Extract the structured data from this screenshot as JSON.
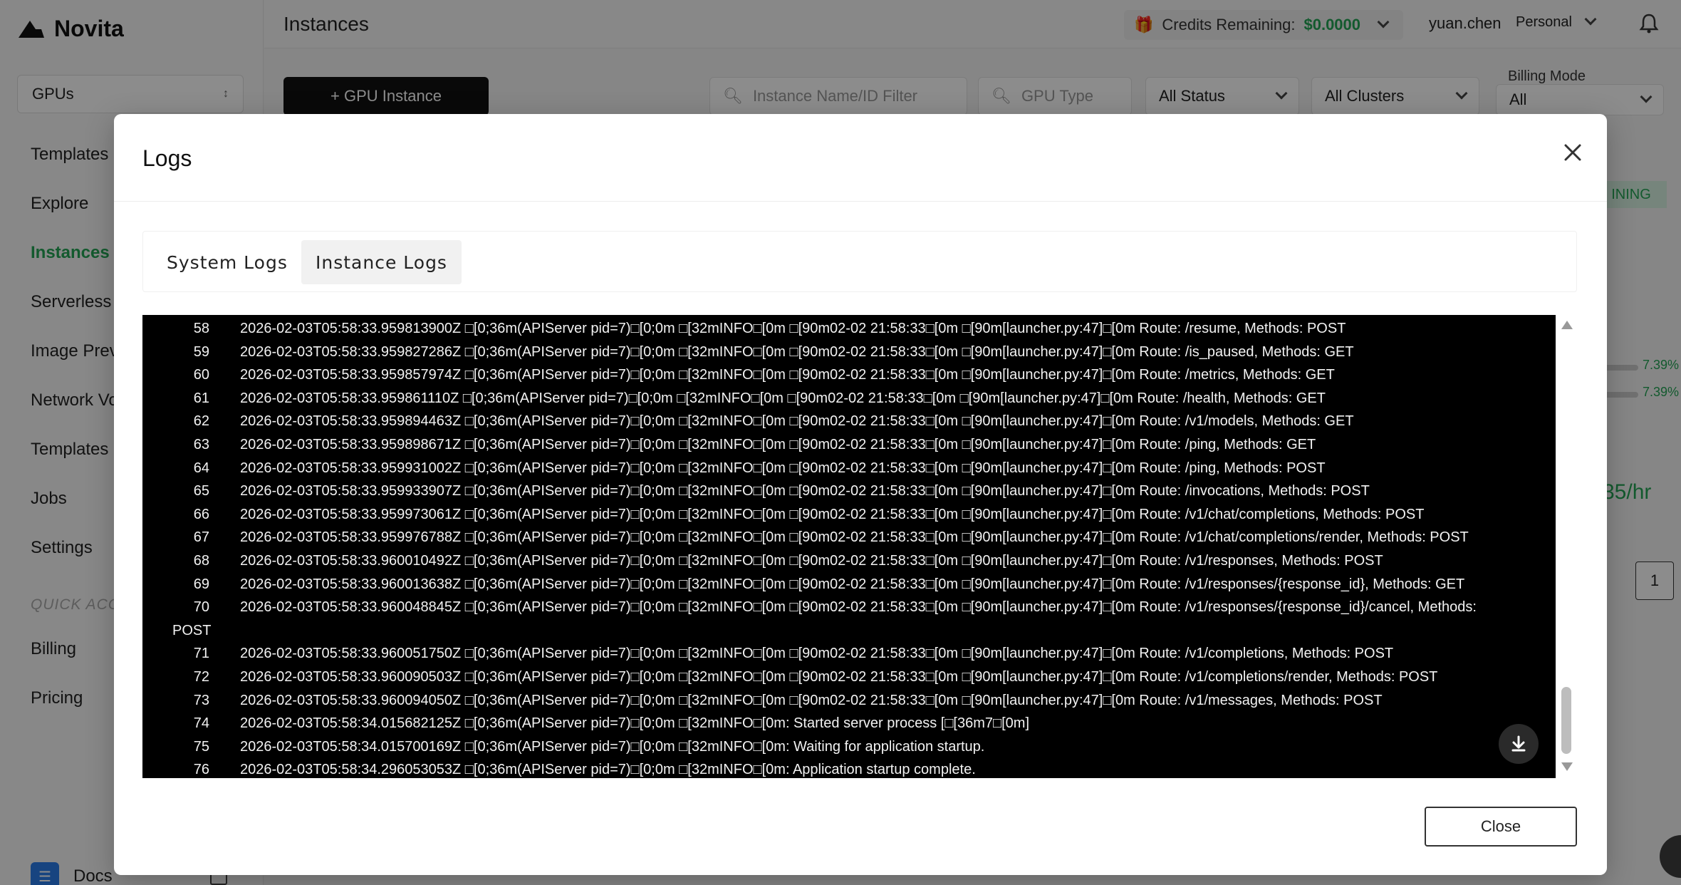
{
  "app": {
    "brand": "Novita",
    "page_title": "Instances",
    "gpu_select": "GPUs",
    "nav": {
      "templates": "Templates",
      "explore": "Explore",
      "instances": "Instances",
      "serverless": "Serverless",
      "image_prewarm": "Image Prev",
      "network_volume": "Network Vo",
      "templates2": "Templates",
      "jobs": "Jobs",
      "settings": "Settings",
      "quick_access": "QUICK ACC",
      "billing": "Billing",
      "pricing": "Pricing",
      "docs": "Docs"
    },
    "credits_label": "Credits Remaining:",
    "credits_amount": "$0.0000",
    "user": "yuan.chen",
    "workspace": "Personal",
    "add_gpu_instance": "+ GPU Instance",
    "filters": {
      "name_placeholder": "Instance Name/ID Filter",
      "gpu_type_placeholder": "GPU Type",
      "status": "All Status",
      "clusters": "All Clusters",
      "billing_mode_label": "Billing Mode",
      "billing_mode": "All"
    },
    "background": {
      "status": "INING",
      "pct1": "7.39%",
      "pct2": "7.39%",
      "price": "35/hr",
      "page": "1"
    },
    "colors": {
      "accent_green": "#23a455",
      "terminal_bg": "#000000"
    }
  },
  "modal": {
    "title": "Logs",
    "tabs": [
      "System Logs",
      "Instance Logs"
    ],
    "active_tab": "Instance Logs",
    "close_label": "Close",
    "log_lines": [
      {
        "num": "58",
        "text": "2026-02-03T05:58:33.959813900Z □[0;36m(APIServer pid=7)□[0;0m □[32mINFO□[0m □[90m02-02 21:58:33□[0m □[90m[launcher.py:47]□[0m Route: /resume, Methods: POST"
      },
      {
        "num": "59",
        "text": "2026-02-03T05:58:33.959827286Z □[0;36m(APIServer pid=7)□[0;0m □[32mINFO□[0m □[90m02-02 21:58:33□[0m □[90m[launcher.py:47]□[0m Route: /is_paused, Methods: GET"
      },
      {
        "num": "60",
        "text": "2026-02-03T05:58:33.959857974Z □[0;36m(APIServer pid=7)□[0;0m □[32mINFO□[0m □[90m02-02 21:58:33□[0m □[90m[launcher.py:47]□[0m Route: /metrics, Methods: GET"
      },
      {
        "num": "61",
        "text": "2026-02-03T05:58:33.959861110Z □[0;36m(APIServer pid=7)□[0;0m □[32mINFO□[0m □[90m02-02 21:58:33□[0m □[90m[launcher.py:47]□[0m Route: /health, Methods: GET"
      },
      {
        "num": "62",
        "text": "2026-02-03T05:58:33.959894463Z □[0;36m(APIServer pid=7)□[0;0m □[32mINFO□[0m □[90m02-02 21:58:33□[0m □[90m[launcher.py:47]□[0m Route: /v1/models, Methods: GET"
      },
      {
        "num": "63",
        "text": "2026-02-03T05:58:33.959898671Z □[0;36m(APIServer pid=7)□[0;0m □[32mINFO□[0m □[90m02-02 21:58:33□[0m □[90m[launcher.py:47]□[0m Route: /ping, Methods: GET"
      },
      {
        "num": "64",
        "text": "2026-02-03T05:58:33.959931002Z □[0;36m(APIServer pid=7)□[0;0m □[32mINFO□[0m □[90m02-02 21:58:33□[0m □[90m[launcher.py:47]□[0m Route: /ping, Methods: POST"
      },
      {
        "num": "65",
        "text": "2026-02-03T05:58:33.959933907Z □[0;36m(APIServer pid=7)□[0;0m □[32mINFO□[0m □[90m02-02 21:58:33□[0m □[90m[launcher.py:47]□[0m Route: /invocations, Methods: POST"
      },
      {
        "num": "66",
        "text": "2026-02-03T05:58:33.959973061Z □[0;36m(APIServer pid=7)□[0;0m □[32mINFO□[0m □[90m02-02 21:58:33□[0m □[90m[launcher.py:47]□[0m Route: /v1/chat/completions, Methods: POST"
      },
      {
        "num": "67",
        "text": "2026-02-03T05:58:33.959976788Z □[0;36m(APIServer pid=7)□[0;0m □[32mINFO□[0m □[90m02-02 21:58:33□[0m □[90m[launcher.py:47]□[0m Route: /v1/chat/completions/render, Methods: POST"
      },
      {
        "num": "68",
        "text": "2026-02-03T05:58:33.960010492Z □[0;36m(APIServer pid=7)□[0;0m □[32mINFO□[0m □[90m02-02 21:58:33□[0m □[90m[launcher.py:47]□[0m Route: /v1/responses, Methods: POST"
      },
      {
        "num": "69",
        "text": "2026-02-03T05:58:33.960013638Z □[0;36m(APIServer pid=7)□[0;0m □[32mINFO□[0m □[90m02-02 21:58:33□[0m □[90m[launcher.py:47]□[0m Route: /v1/responses/{response_id}, Methods: GET"
      },
      {
        "num": "70",
        "text": "2026-02-03T05:58:33.960048845Z □[0;36m(APIServer pid=7)□[0;0m □[32mINFO□[0m □[90m02-02 21:58:33□[0m □[90m[launcher.py:47]□[0m Route: /v1/responses/{response_id}/cancel, Methods:",
        "wrap": "POST"
      },
      {
        "num": "71",
        "text": "2026-02-03T05:58:33.960051750Z □[0;36m(APIServer pid=7)□[0;0m □[32mINFO□[0m □[90m02-02 21:58:33□[0m □[90m[launcher.py:47]□[0m Route: /v1/completions, Methods: POST"
      },
      {
        "num": "72",
        "text": "2026-02-03T05:58:33.960090503Z □[0;36m(APIServer pid=7)□[0;0m □[32mINFO□[0m □[90m02-02 21:58:33□[0m □[90m[launcher.py:47]□[0m Route: /v1/completions/render, Methods: POST"
      },
      {
        "num": "73",
        "text": "2026-02-03T05:58:33.960094050Z □[0;36m(APIServer pid=7)□[0;0m □[32mINFO□[0m □[90m02-02 21:58:33□[0m □[90m[launcher.py:47]□[0m Route: /v1/messages, Methods: POST"
      },
      {
        "num": "74",
        "text": "2026-02-03T05:58:34.015682125Z □[0;36m(APIServer pid=7)□[0;0m □[32mINFO□[0m: Started server process [□[36m7□[0m]"
      },
      {
        "num": "75",
        "text": "2026-02-03T05:58:34.015700169Z □[0;36m(APIServer pid=7)□[0;0m □[32mINFO□[0m: Waiting for application startup."
      },
      {
        "num": "76",
        "text": "2026-02-03T05:58:34.296053053Z □[0;36m(APIServer pid=7)□[0;0m □[32mINFO□[0m: Application startup complete."
      }
    ]
  }
}
